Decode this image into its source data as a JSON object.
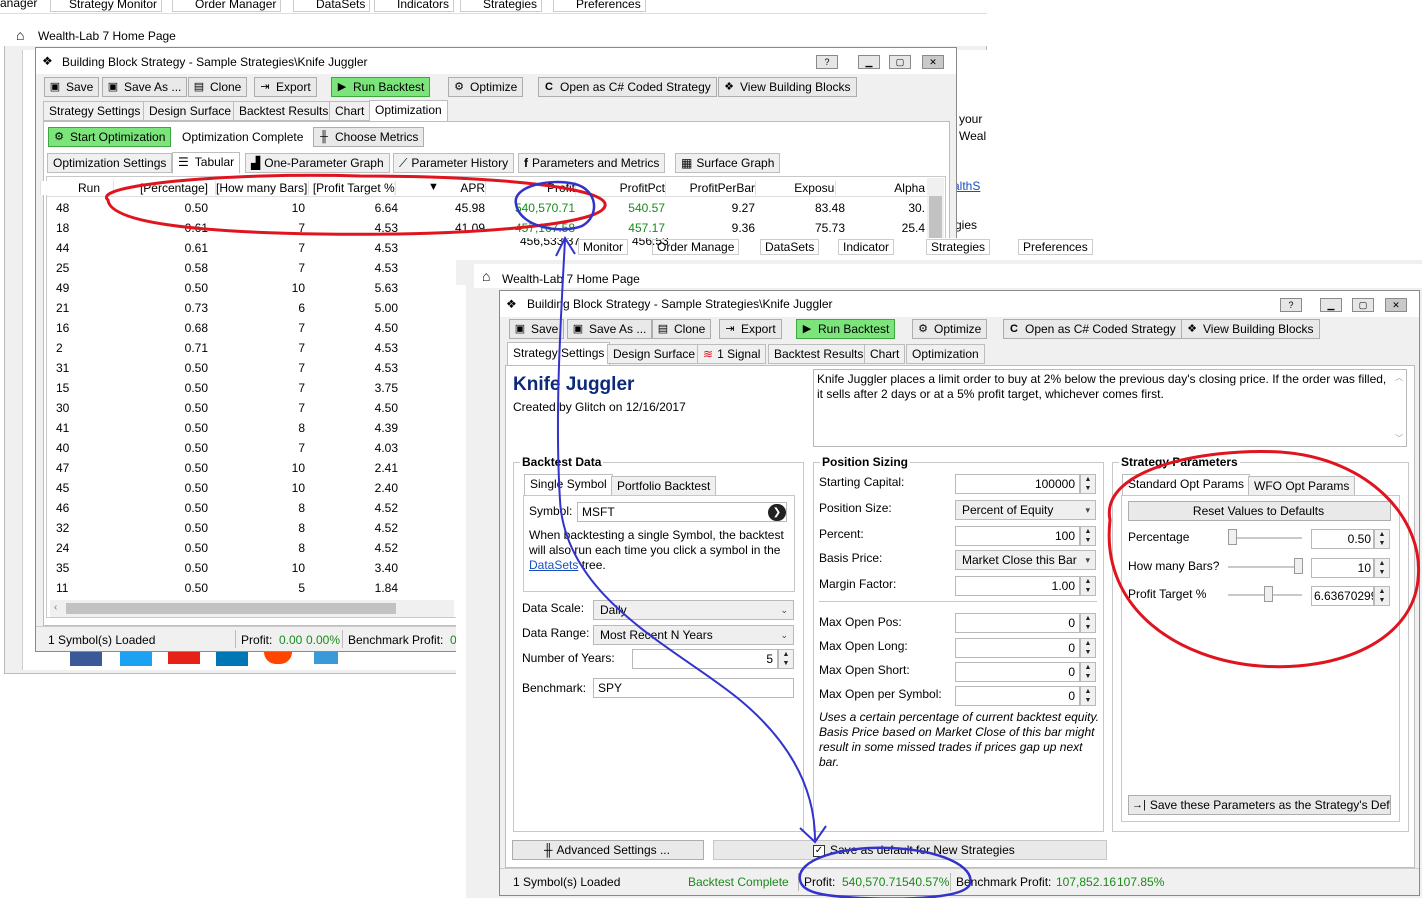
{
  "top_toolbar": {
    "items": [
      "anager",
      "Strategy Monitor",
      "Order Manager",
      "DataSets",
      "Indicators",
      "Strategies",
      "Preferences"
    ]
  },
  "back_window": {
    "home_title": "Wealth-Lab 7 Home Page",
    "title": "Building Block Strategy - Sample Strategies\\Knife Juggler",
    "win_help": "?",
    "toolbar": {
      "save": "Save",
      "save_as": "Save As ...",
      "clone": "Clone",
      "export": "Export",
      "run_backtest": "Run Backtest",
      "optimize": "Optimize",
      "open_cs": "Open as C# Coded Strategy",
      "view_blocks": "View Building Blocks"
    },
    "tabs": [
      "Strategy Settings",
      "Design Surface",
      "Backtest Results",
      "Chart",
      "Optimization"
    ],
    "opt_toolbar": {
      "start": "Start Optimization",
      "complete": "Optimization Complete",
      "choose": "Choose Metrics"
    },
    "subtabs": [
      "Optimization Settings",
      "Tabular",
      "One-Parameter Graph",
      "Parameter History",
      "Parameters and Metrics",
      "Surface Graph"
    ],
    "columns": [
      "Run",
      "[Percentage]",
      "[How many Bars]",
      "[Profit Target %]",
      "APR",
      "Profit",
      "ProfitPct",
      "ProfitPerBar",
      "Exposure",
      "Alpha"
    ],
    "rows": [
      [
        "48",
        "0.50",
        "10",
        "6.64",
        "45.98",
        "540,570.71",
        "540.57",
        "9.27",
        "83.48",
        "30."
      ],
      [
        "18",
        "0.61",
        "7",
        "4.53",
        "41.09",
        "457,167.58",
        "457.17",
        "9.36",
        "75.73",
        "25.4"
      ],
      [
        "44",
        "0.61",
        "7",
        "4.53",
        "",
        "",
        "",
        "",
        "",
        ""
      ],
      [
        "25",
        "0.58",
        "7",
        "4.53",
        "",
        "",
        "",
        "",
        "",
        ""
      ],
      [
        "49",
        "0.50",
        "10",
        "5.63",
        "",
        "",
        "",
        "",
        "",
        ""
      ],
      [
        "21",
        "0.73",
        "6",
        "5.00",
        "",
        "",
        "",
        "",
        "",
        ""
      ],
      [
        "16",
        "0.68",
        "7",
        "4.50",
        "",
        "",
        "",
        "",
        "",
        ""
      ],
      [
        "2",
        "0.71",
        "7",
        "4.53",
        "",
        "",
        "",
        "",
        "",
        ""
      ],
      [
        "31",
        "0.50",
        "7",
        "4.53",
        "",
        "",
        "",
        "",
        "",
        ""
      ],
      [
        "15",
        "0.50",
        "7",
        "3.75",
        "",
        "",
        "",
        "",
        "",
        ""
      ],
      [
        "30",
        "0.50",
        "7",
        "4.50",
        "",
        "",
        "",
        "",
        "",
        ""
      ],
      [
        "41",
        "0.50",
        "8",
        "4.39",
        "",
        "",
        "",
        "",
        "",
        ""
      ],
      [
        "40",
        "0.50",
        "7",
        "4.03",
        "",
        "",
        "",
        "",
        "",
        ""
      ],
      [
        "47",
        "0.50",
        "10",
        "2.41",
        "",
        "",
        "",
        "",
        "",
        ""
      ],
      [
        "45",
        "0.50",
        "10",
        "2.40",
        "",
        "",
        "",
        "",
        "",
        ""
      ],
      [
        "46",
        "0.50",
        "8",
        "4.52",
        "",
        "",
        "",
        "",
        "",
        ""
      ],
      [
        "32",
        "0.50",
        "8",
        "4.52",
        "",
        "",
        "",
        "",
        "",
        ""
      ],
      [
        "24",
        "0.50",
        "8",
        "4.52",
        "",
        "",
        "",
        "",
        "",
        ""
      ],
      [
        "35",
        "0.50",
        "10",
        "3.40",
        "",
        "",
        "",
        "",
        "",
        ""
      ],
      [
        "11",
        "0.50",
        "5",
        "1.84",
        "",
        "",
        "",
        "",
        "",
        ""
      ]
    ],
    "status": {
      "loaded": "1 Symbol(s) Loaded",
      "profit_label": "Profit:",
      "profit_value": "0.00",
      "profit_pct": "0.00%",
      "benchmark_label": "Benchmark Profit:",
      "benchmark_value": "0"
    },
    "side_text": [
      "your",
      "Weal",
      "althS",
      "gies"
    ]
  },
  "front_window": {
    "home_title": "Wealth-Lab 7 Home Page",
    "behind_strip": [
      "Monitor",
      "Order Manage",
      "DataSets",
      "Indicator",
      "Strategies",
      "Preferences"
    ],
    "behind_strip_nums": [
      "456,533.37",
      "456.53",
      "9.36",
      "75.73"
    ],
    "title": "Building Block Strategy - Sample Strategies\\Knife Juggler",
    "win_help": "?",
    "toolbar": {
      "save": "Save",
      "save_as": "Save As ...",
      "clone": "Clone",
      "export": "Export",
      "run_backtest": "Run Backtest",
      "optimize": "Optimize",
      "open_cs": "Open as C# Coded Strategy",
      "view_blocks": "View Building Blocks"
    },
    "tabs": [
      "Strategy Settings",
      "Design Surface",
      "1 Signal",
      "Backtest Results",
      "Chart",
      "Optimization"
    ],
    "strategy_name": "Knife Juggler",
    "created_by": "Created by Glitch on 12/16/2017",
    "description": "Knife Juggler places a limit order to buy at 2% below the previous day's closing price. If the order was filled, it sells after 2 days or at a 5% profit target, whichever comes first.",
    "backtest_data": {
      "title": "Backtest Data",
      "tabs": [
        "Single Symbol",
        "Portfolio Backtest"
      ],
      "symbol_label": "Symbol:",
      "symbol_value": "MSFT",
      "help": "When backtesting a single Symbol, the backtest will also run each time you click a symbol in the",
      "link": "DataSets",
      "help_end": "tree.",
      "scale_label": "Data Scale:",
      "scale_value": "Daily",
      "range_label": "Data Range:",
      "range_value": "Most Recent N Years",
      "years_label": "Number of Years:",
      "years_value": "5",
      "benchmark_label": "Benchmark:",
      "benchmark_value": "SPY"
    },
    "position_sizing": {
      "title": "Position Sizing",
      "capital_label": "Starting Capital:",
      "capital_value": "100000",
      "size_label": "Position Size:",
      "size_value": "Percent of Equity",
      "percent_label": "Percent:",
      "percent_value": "100",
      "basis_label": "Basis Price:",
      "basis_value": "Market Close this Bar",
      "margin_label": "Margin Factor:",
      "margin_value": "1.00",
      "max_open_pos_label": "Max Open Pos:",
      "max_open_pos_value": "0",
      "max_open_long_label": "Max Open Long:",
      "max_open_long_value": "0",
      "max_open_short_label": "Max Open Short:",
      "max_open_short_value": "0",
      "max_open_sym_label": "Max Open per Symbol:",
      "max_open_sym_value": "0",
      "note": "Uses a certain percentage of current backtest equity. Basis Price based on Market Close of this bar might result in some missed trades if prices gap up next bar."
    },
    "strategy_params": {
      "title": "Strategy Parameters",
      "tabs": [
        "Standard Opt Params",
        "WFO Opt Params"
      ],
      "reset": "Reset Values to Defaults",
      "params": [
        {
          "label": "Percentage",
          "value": "0.50",
          "level": 0.0
        },
        {
          "label": "How many Bars?",
          "value": "10",
          "level": 1.0
        },
        {
          "label": "Profit Target %",
          "value": "6.63670299",
          "level": 0.55
        }
      ],
      "save_params": "Save these Parameters as the Strategy's Defau"
    },
    "advanced": "Advanced Settings ...",
    "save_default": "Save as default for New Strategies",
    "status": {
      "loaded": "1 Symbol(s) Loaded",
      "complete": "Backtest Complete",
      "profit_label": "Profit:",
      "profit_value": "540,570.71",
      "profit_pct": "540.57%",
      "benchmark_label": "Benchmark Profit:",
      "benchmark_value": "107,852.16",
      "benchmark_pct": "107.85%"
    }
  },
  "colors": {
    "green_text": "#1a8a1a",
    "run_green": "#7be57b",
    "annotation_red": "#e0141e",
    "annotation_blue": "#3333cc",
    "link": "#1a4fc2"
  }
}
